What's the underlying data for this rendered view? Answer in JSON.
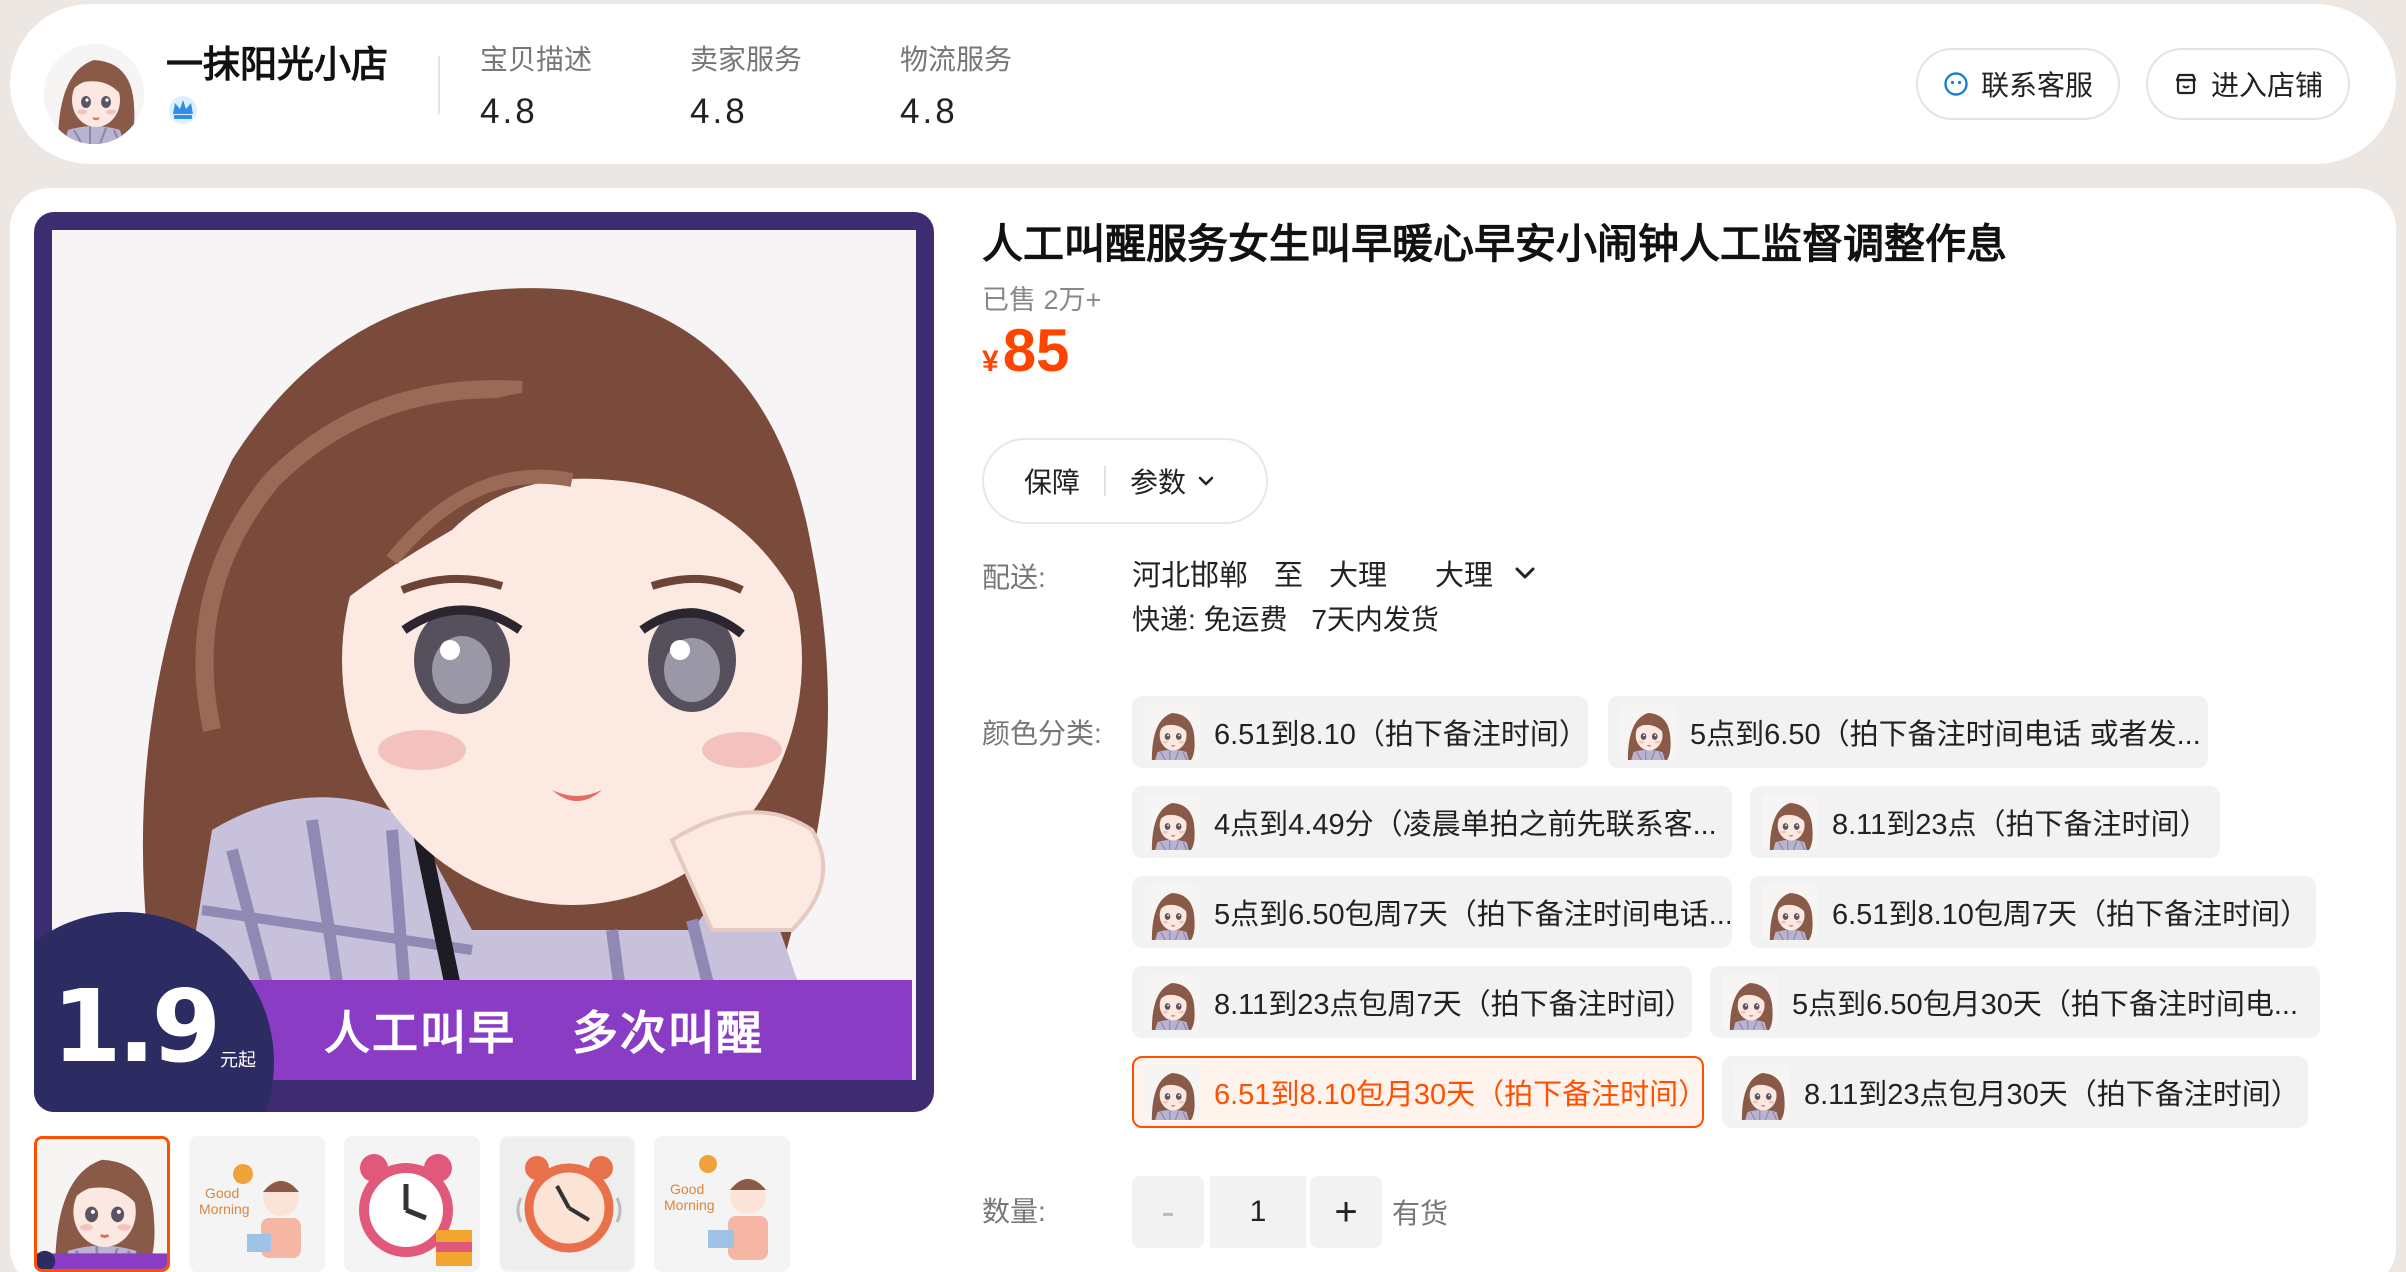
{
  "store": {
    "name": "一抹阳光小店",
    "metrics": [
      {
        "label": "宝贝描述",
        "value": "4.8"
      },
      {
        "label": "卖家服务",
        "value": "4.8"
      },
      {
        "label": "物流服务",
        "value": "4.8"
      }
    ],
    "contact_label": "联系客服",
    "enter_label": "进入店铺"
  },
  "gallery": {
    "banner_left": "人工叫早",
    "banner_right": "多次叫醒",
    "promo_price": "1.9",
    "promo_unit": "元起",
    "thumb_count": 5,
    "active_thumb": 0
  },
  "product": {
    "title": "人工叫醒服务女生叫早暖心早安小闹钟人工监督调整作息",
    "sold": "已售 2万+",
    "currency": "¥",
    "price": "85",
    "tab_guarantee": "保障",
    "tab_params": "参数"
  },
  "shipping": {
    "label": "配送:",
    "from": "河北邯郸",
    "to_word": "至",
    "dest1": "大理",
    "dest2": "大理",
    "method": "快递: 免运费",
    "dispatch": "7天内发货"
  },
  "options": {
    "label": "颜色分类:",
    "items": [
      "6.51到8.10（拍下备注时间）",
      "5点到6.50（拍下备注时间电话 或者发...",
      "4点到4.49分（凌晨单拍之前先联系客...",
      "8.11到23点（拍下备注时间）",
      "5点到6.50包周7天（拍下备注时间电话...",
      "6.51到8.10包周7天（拍下备注时间）",
      "8.11到23点包周7天（拍下备注时间）",
      "5点到6.50包月30天（拍下备注时间电...",
      "6.51到8.10包月30天（拍下备注时间）",
      "8.11到23点包月30天（拍下备注时间）"
    ],
    "selected_index": 8
  },
  "quantity": {
    "label": "数量:",
    "minus": "-",
    "value": "1",
    "plus": "+",
    "stock": "有货"
  },
  "colors": {
    "accent": "#ff5000",
    "price": "#ff4400",
    "banner": "#8a3cc4",
    "hero_frame": "#3e2c70"
  }
}
